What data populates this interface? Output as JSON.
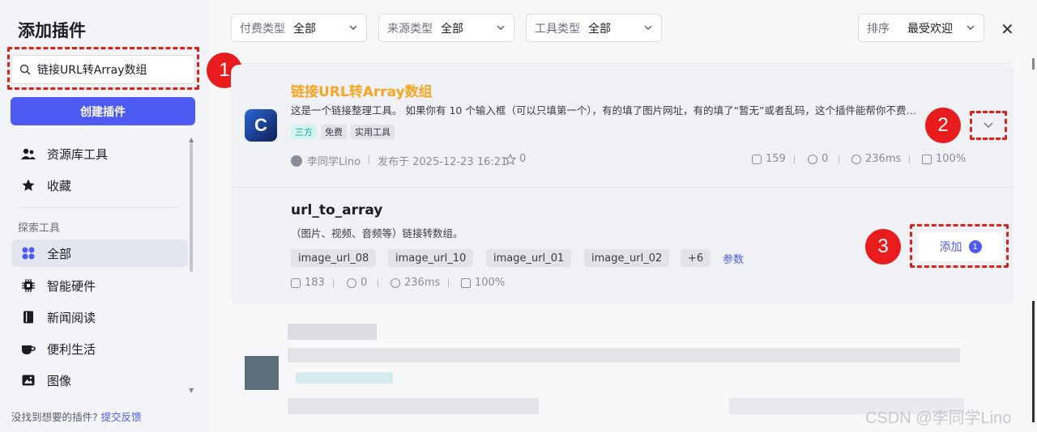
{
  "sidebar": {
    "title": "添加插件",
    "search_value": "链接URL转Array数组",
    "create_label": "创建插件",
    "items": [
      {
        "label": "资源库工具"
      },
      {
        "label": "收藏"
      }
    ],
    "section_label": "探索工具",
    "categories": [
      {
        "label": "全部"
      },
      {
        "label": "智能硬件"
      },
      {
        "label": "新闻阅读"
      },
      {
        "label": "便利生活"
      },
      {
        "label": "图像"
      }
    ],
    "feedback_text": "没找到想要的插件?",
    "feedback_link": "提交反馈"
  },
  "filters": [
    {
      "label": "付费类型",
      "value": "全部"
    },
    {
      "label": "来源类型",
      "value": "全部"
    },
    {
      "label": "工具类型",
      "value": "全部"
    }
  ],
  "sort": {
    "label": "排序",
    "value": "最受欢迎"
  },
  "plugin": {
    "title": "链接URL转Array数组",
    "description": "这是一个链接整理工具。 如果你有 10 个输入框（可以只填第一个），有的填了图片网址，有的填了“暂无”或者乱码，这个插件能帮你不费…",
    "tags": [
      "三方",
      "免费",
      "实用工具"
    ],
    "author": "李同学Lino",
    "published": "发布于 2025-12-23 16:21",
    "stars": "0",
    "calls": "159",
    "comments": "0",
    "latency": "236ms",
    "success": "100%"
  },
  "tool": {
    "name": "url_to_array",
    "description": "（图片、视频、音频等）链接转数组。",
    "params": [
      "image_url_08",
      "image_url_10",
      "image_url_01",
      "image_url_02",
      "+6"
    ],
    "params_link": "参数",
    "add_label": "添加",
    "add_count": "1",
    "calls": "183",
    "comments": "0",
    "latency": "236ms",
    "success": "100%"
  },
  "annotations": [
    "1",
    "2",
    "3"
  ],
  "watermark": "CSDN @李同学Lino",
  "colors": {
    "accent": "#4e5bf2",
    "title": "#f5a623",
    "annotation": "#e81c1c"
  }
}
